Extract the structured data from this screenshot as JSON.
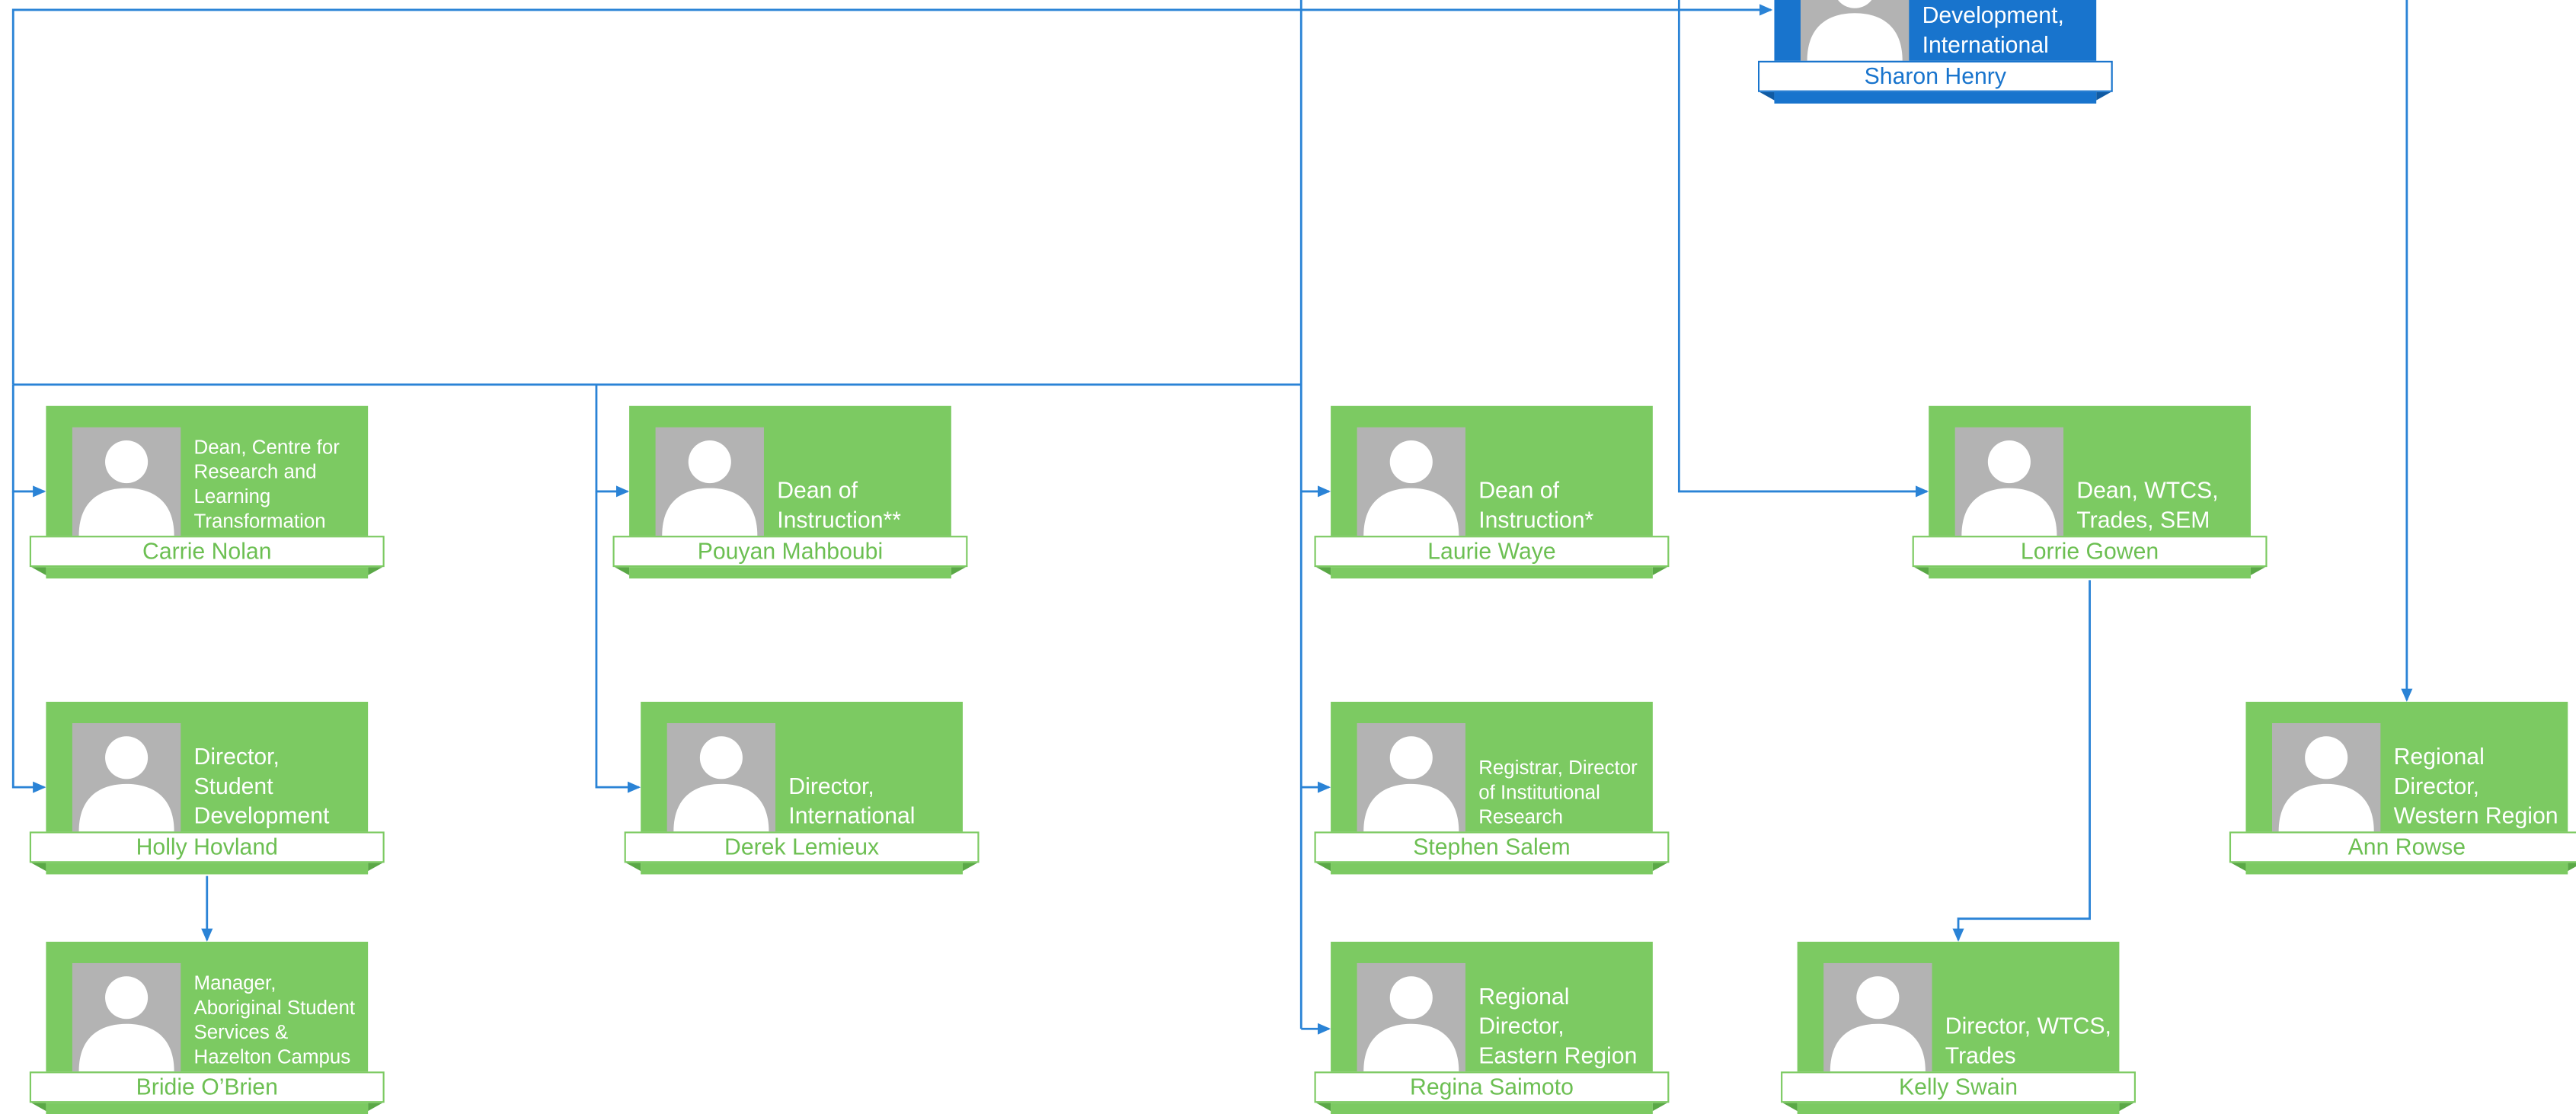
{
  "colors": {
    "card_green": "#7cca62",
    "card_blue": "#1874cd",
    "connector": "#2a83d6",
    "photo_placeholder": "#b3b3b3"
  },
  "people": [
    {
      "id": "sharon-henry",
      "name": "Sharon Henry",
      "title": "Student Development, International",
      "color": "blue",
      "icon": "person-silhouette-icon"
    },
    {
      "id": "carrie-nolan",
      "name": "Carrie Nolan",
      "title": "Dean, Centre for Research and Learning Transformation",
      "color": "green",
      "icon": "person-silhouette-icon"
    },
    {
      "id": "pouyan-mahboubi",
      "name": "Pouyan Mahboubi",
      "title": "Dean of Instruction**",
      "color": "green",
      "icon": "person-silhouette-icon"
    },
    {
      "id": "laurie-waye",
      "name": "Laurie Waye",
      "title": "Dean of Instruction*",
      "color": "green",
      "icon": "person-silhouette-icon"
    },
    {
      "id": "lorrie-gowen",
      "name": "Lorrie Gowen",
      "title": "Dean, WTCS, Trades, SEM",
      "color": "green",
      "icon": "person-silhouette-icon"
    },
    {
      "id": "holly-hovland",
      "name": "Holly Hovland",
      "title": "Director, Student Development",
      "color": "green",
      "icon": "person-silhouette-icon"
    },
    {
      "id": "derek-lemieux",
      "name": "Derek Lemieux",
      "title": "Director, International",
      "color": "green",
      "icon": "person-silhouette-icon"
    },
    {
      "id": "stephen-salem",
      "name": "Stephen Salem",
      "title": "Registrar, Director of Institutional Research",
      "color": "green",
      "icon": "person-silhouette-icon"
    },
    {
      "id": "ann-rowse",
      "name": "Ann Rowse",
      "title": "Regional Director, Western Region",
      "color": "green",
      "icon": "person-silhouette-icon"
    },
    {
      "id": "bridie-obrien",
      "name": "Bridie O’Brien",
      "title": "Manager, Aboriginal Student Services & Hazelton Campus",
      "color": "green",
      "icon": "person-silhouette-icon"
    },
    {
      "id": "regina-saimoto",
      "name": "Regina Saimoto",
      "title": "Regional Director, Eastern Region",
      "color": "green",
      "icon": "person-silhouette-icon"
    },
    {
      "id": "kelly-swain",
      "name": "Kelly Swain",
      "title": "Director, WTCS, Trades",
      "color": "green",
      "icon": "person-silhouette-icon"
    }
  ],
  "reports_to": [
    {
      "from": "lorrie-gowen",
      "to": "kelly-swain"
    },
    {
      "from": "holly-hovland",
      "to": "bridie-obrien"
    }
  ]
}
